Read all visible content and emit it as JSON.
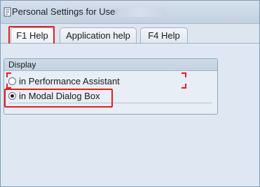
{
  "window": {
    "title": "Personal Settings for User",
    "user_masked": true
  },
  "tabs": [
    {
      "label": "F1 Help",
      "active": true
    },
    {
      "label": "Application help",
      "active": false
    },
    {
      "label": "F4 Help",
      "active": false
    }
  ],
  "display_group": {
    "title": "Display",
    "options": [
      {
        "label": "in Performance Assistant",
        "selected": false
      },
      {
        "label": "in Modal Dialog Box",
        "selected": true
      }
    ]
  },
  "icons": {
    "title": "settings-document-icon"
  },
  "colors": {
    "highlight": "#e02020",
    "titlebar": "#c8d6e5",
    "content_bg": "#dfe8f2",
    "border": "#8fa4bb"
  }
}
